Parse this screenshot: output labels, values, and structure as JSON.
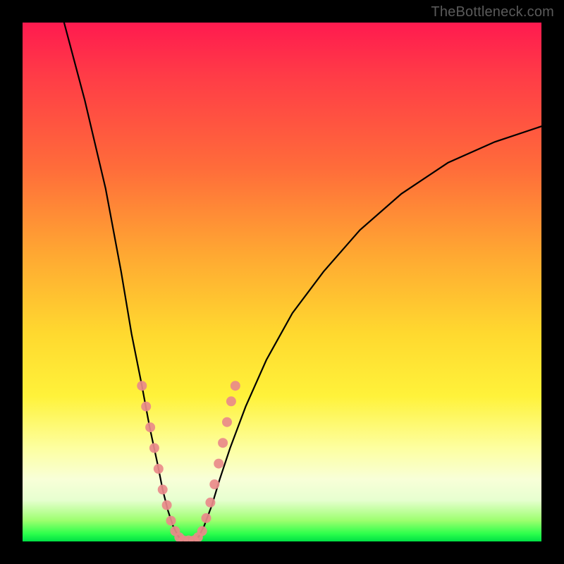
{
  "watermark": "TheBottleneck.com",
  "chart_data": {
    "type": "line",
    "title": "",
    "xlabel": "",
    "ylabel": "",
    "xlim": [
      0,
      100
    ],
    "ylim": [
      0,
      100
    ],
    "curve": {
      "name": "bottleneck-v-curve",
      "points": [
        {
          "x": 8,
          "y": 100
        },
        {
          "x": 12,
          "y": 85
        },
        {
          "x": 16,
          "y": 68
        },
        {
          "x": 19,
          "y": 52
        },
        {
          "x": 21,
          "y": 40
        },
        {
          "x": 23,
          "y": 30
        },
        {
          "x": 24.5,
          "y": 22
        },
        {
          "x": 26,
          "y": 15
        },
        {
          "x": 27,
          "y": 10
        },
        {
          "x": 28,
          "y": 6
        },
        {
          "x": 29,
          "y": 3
        },
        {
          "x": 30,
          "y": 1
        },
        {
          "x": 31,
          "y": 0
        },
        {
          "x": 33,
          "y": 0
        },
        {
          "x": 34,
          "y": 1
        },
        {
          "x": 35,
          "y": 3
        },
        {
          "x": 36.5,
          "y": 7
        },
        {
          "x": 38,
          "y": 12
        },
        {
          "x": 40,
          "y": 18
        },
        {
          "x": 43,
          "y": 26
        },
        {
          "x": 47,
          "y": 35
        },
        {
          "x": 52,
          "y": 44
        },
        {
          "x": 58,
          "y": 52
        },
        {
          "x": 65,
          "y": 60
        },
        {
          "x": 73,
          "y": 67
        },
        {
          "x": 82,
          "y": 73
        },
        {
          "x": 91,
          "y": 77
        },
        {
          "x": 100,
          "y": 80
        }
      ]
    },
    "markers": {
      "name": "highlighted-range-dots",
      "color": "#e98a8a",
      "radius_px": 7,
      "points": [
        {
          "x": 23.0,
          "y": 30
        },
        {
          "x": 23.8,
          "y": 26
        },
        {
          "x": 24.6,
          "y": 22
        },
        {
          "x": 25.4,
          "y": 18
        },
        {
          "x": 26.2,
          "y": 14
        },
        {
          "x": 27.0,
          "y": 10
        },
        {
          "x": 27.8,
          "y": 7
        },
        {
          "x": 28.6,
          "y": 4
        },
        {
          "x": 29.4,
          "y": 2
        },
        {
          "x": 30.2,
          "y": 0.8
        },
        {
          "x": 31.0,
          "y": 0.2
        },
        {
          "x": 32.0,
          "y": 0.2
        },
        {
          "x": 33.0,
          "y": 0.2
        },
        {
          "x": 33.8,
          "y": 0.8
        },
        {
          "x": 34.6,
          "y": 2
        },
        {
          "x": 35.4,
          "y": 4.5
        },
        {
          "x": 36.2,
          "y": 7.5
        },
        {
          "x": 37.0,
          "y": 11
        },
        {
          "x": 37.8,
          "y": 15
        },
        {
          "x": 38.6,
          "y": 19
        },
        {
          "x": 39.4,
          "y": 23
        },
        {
          "x": 40.2,
          "y": 27
        },
        {
          "x": 41.0,
          "y": 30
        }
      ]
    }
  }
}
